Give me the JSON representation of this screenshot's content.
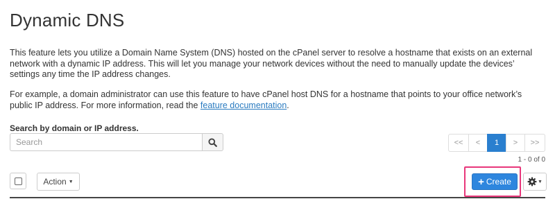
{
  "header": {
    "title": "Dynamic DNS"
  },
  "intro": {
    "paragraph1": "This feature lets you utilize a Domain Name System (DNS) hosted on the cPanel server to resolve a hostname that exists on an external network with a dynamic IP address. This will let you manage your network devices without the need to manually update the devices’ settings any time the IP address changes.",
    "paragraph2_text": "For example, a domain administrator can use this feature to have cPanel host DNS for a hostname that points to your office network’s public IP address. For more information, read the ",
    "paragraph2_link": "feature documentation",
    "paragraph2_end": "."
  },
  "search": {
    "label": "Search by domain or IP address.",
    "placeholder": "Search",
    "value": "",
    "button_icon": "search-icon"
  },
  "pagination": {
    "first": "<<",
    "prev": "<",
    "current": "1",
    "next": ">",
    "last": ">>",
    "count_text": "1 - 0 of 0"
  },
  "toolbar": {
    "action_label": "Action",
    "create_label": "Create",
    "create_icon": "plus-icon",
    "settings_icon": "gear-icon"
  },
  "colors": {
    "primary": "#2e86de",
    "highlight": "#e8367a",
    "link": "#2a7bc0"
  }
}
